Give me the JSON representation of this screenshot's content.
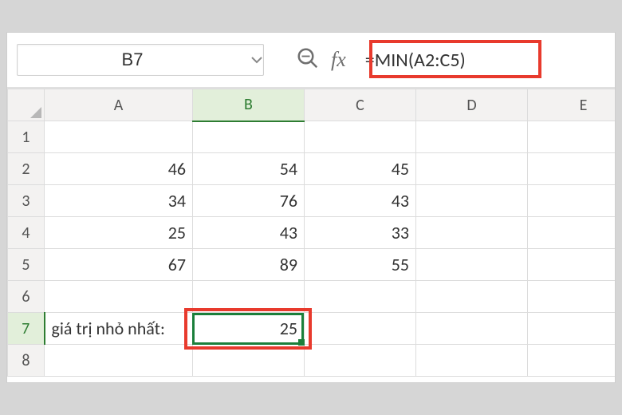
{
  "namebox": {
    "value": "B7"
  },
  "formula_bar": {
    "text": "=MIN(A2:C5)"
  },
  "columns": [
    "A",
    "B",
    "C",
    "D",
    "E"
  ],
  "rows": [
    "1",
    "2",
    "3",
    "4",
    "5",
    "6",
    "7",
    "8"
  ],
  "cells": {
    "A2": "46",
    "B2": "54",
    "C2": "45",
    "A3": "34",
    "B3": "76",
    "C3": "43",
    "A4": "25",
    "B4": "43",
    "C4": "33",
    "A5": "67",
    "B5": "89",
    "C5": "55",
    "A7": "giá trị nhỏ nhất:",
    "B7": "25"
  },
  "active_cell": "B7",
  "chart_data": {
    "type": "table",
    "title": "",
    "columns": [
      "A",
      "B",
      "C"
    ],
    "rows": [
      [
        46,
        54,
        45
      ],
      [
        34,
        76,
        43
      ],
      [
        25,
        43,
        33
      ],
      [
        67,
        89,
        55
      ]
    ],
    "annotation": {
      "label": "giá trị nhỏ nhất:",
      "value": 25,
      "formula": "=MIN(A2:C5)"
    }
  },
  "icons": {
    "search": "search-icon",
    "fx": "fx-icon",
    "dropdown": "chevron-down-icon"
  }
}
